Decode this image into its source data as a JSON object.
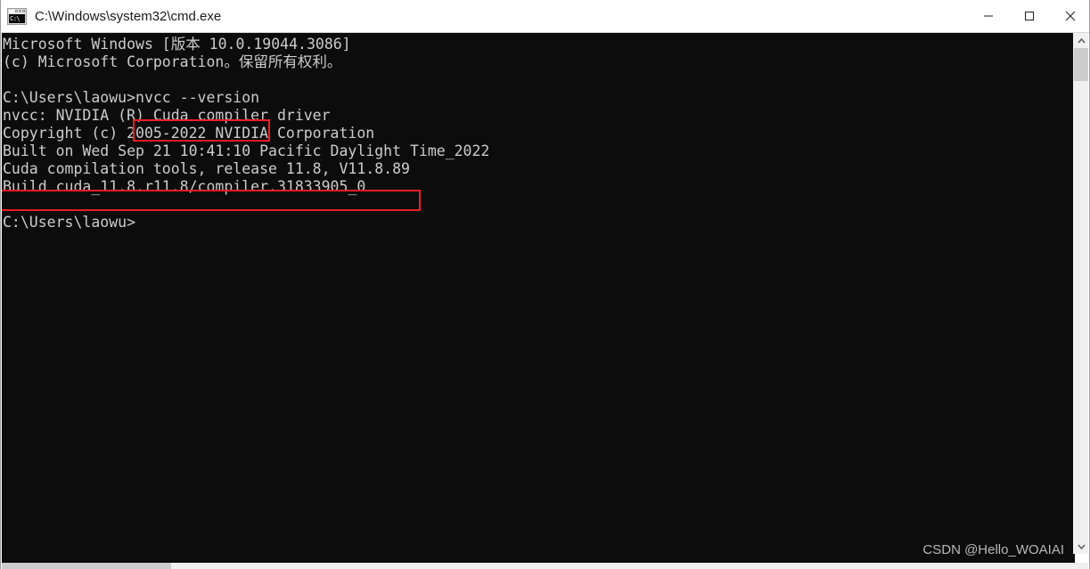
{
  "window": {
    "title": "C:\\Windows\\system32\\cmd.exe",
    "icon_name": "cmd-icon",
    "icon_text": "C:\\",
    "controls": {
      "minimize_label": "Minimize",
      "maximize_label": "Maximize",
      "close_label": "Close"
    }
  },
  "terminal": {
    "background_color": "#0c0c0c",
    "text_color": "#cccccc",
    "lines": [
      "Microsoft Windows [版本 10.0.19044.3086]",
      "(c) Microsoft Corporation。保留所有权利。",
      "",
      "C:\\Users\\laowu>nvcc --version",
      "nvcc: NVIDIA (R) Cuda compiler driver",
      "Copyright (c) 2005-2022 NVIDIA Corporation",
      "Built on Wed Sep 21 10:41:10 Pacific Daylight Time_2022",
      "Cuda compilation tools, release 11.8, V11.8.89",
      "Build cuda_11.8.r11.8/compiler.31833905_0",
      "",
      "C:\\Users\\laowu>"
    ]
  },
  "annotations": {
    "color": "#ee1c25",
    "boxes": [
      {
        "name": "command-highlight",
        "text": "nvcc --version"
      },
      {
        "name": "release-version-highlight",
        "text": "Cuda compilation tools, release 11.8, V11.8.89"
      }
    ]
  },
  "watermark": {
    "text": "CSDN @Hello_WOAIAI"
  },
  "scrollbars": {
    "vertical": {
      "up_arrow": "▲",
      "down_arrow": "▼",
      "thumb_position": "top"
    },
    "horizontal": {
      "thumb_position": "left"
    }
  }
}
